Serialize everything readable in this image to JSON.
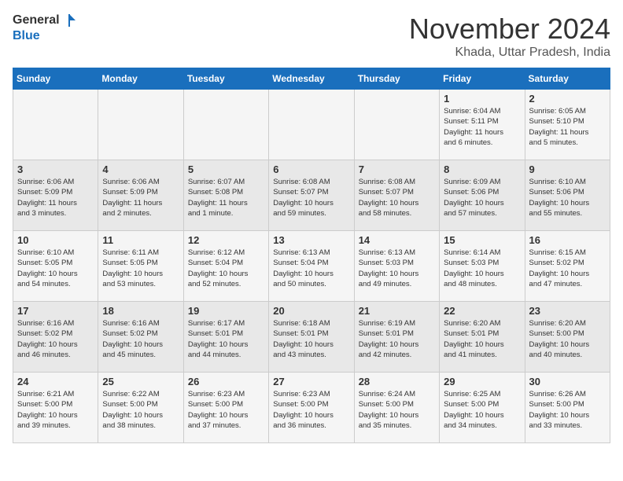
{
  "header": {
    "logo_general": "General",
    "logo_blue": "Blue",
    "month_title": "November 2024",
    "subtitle": "Khada, Uttar Pradesh, India"
  },
  "weekdays": [
    "Sunday",
    "Monday",
    "Tuesday",
    "Wednesday",
    "Thursday",
    "Friday",
    "Saturday"
  ],
  "weeks": [
    [
      {
        "day": "",
        "info": ""
      },
      {
        "day": "",
        "info": ""
      },
      {
        "day": "",
        "info": ""
      },
      {
        "day": "",
        "info": ""
      },
      {
        "day": "",
        "info": ""
      },
      {
        "day": "1",
        "info": "Sunrise: 6:04 AM\nSunset: 5:11 PM\nDaylight: 11 hours\nand 6 minutes."
      },
      {
        "day": "2",
        "info": "Sunrise: 6:05 AM\nSunset: 5:10 PM\nDaylight: 11 hours\nand 5 minutes."
      }
    ],
    [
      {
        "day": "3",
        "info": "Sunrise: 6:06 AM\nSunset: 5:09 PM\nDaylight: 11 hours\nand 3 minutes."
      },
      {
        "day": "4",
        "info": "Sunrise: 6:06 AM\nSunset: 5:09 PM\nDaylight: 11 hours\nand 2 minutes."
      },
      {
        "day": "5",
        "info": "Sunrise: 6:07 AM\nSunset: 5:08 PM\nDaylight: 11 hours\nand 1 minute."
      },
      {
        "day": "6",
        "info": "Sunrise: 6:08 AM\nSunset: 5:07 PM\nDaylight: 10 hours\nand 59 minutes."
      },
      {
        "day": "7",
        "info": "Sunrise: 6:08 AM\nSunset: 5:07 PM\nDaylight: 10 hours\nand 58 minutes."
      },
      {
        "day": "8",
        "info": "Sunrise: 6:09 AM\nSunset: 5:06 PM\nDaylight: 10 hours\nand 57 minutes."
      },
      {
        "day": "9",
        "info": "Sunrise: 6:10 AM\nSunset: 5:06 PM\nDaylight: 10 hours\nand 55 minutes."
      }
    ],
    [
      {
        "day": "10",
        "info": "Sunrise: 6:10 AM\nSunset: 5:05 PM\nDaylight: 10 hours\nand 54 minutes."
      },
      {
        "day": "11",
        "info": "Sunrise: 6:11 AM\nSunset: 5:05 PM\nDaylight: 10 hours\nand 53 minutes."
      },
      {
        "day": "12",
        "info": "Sunrise: 6:12 AM\nSunset: 5:04 PM\nDaylight: 10 hours\nand 52 minutes."
      },
      {
        "day": "13",
        "info": "Sunrise: 6:13 AM\nSunset: 5:04 PM\nDaylight: 10 hours\nand 50 minutes."
      },
      {
        "day": "14",
        "info": "Sunrise: 6:13 AM\nSunset: 5:03 PM\nDaylight: 10 hours\nand 49 minutes."
      },
      {
        "day": "15",
        "info": "Sunrise: 6:14 AM\nSunset: 5:03 PM\nDaylight: 10 hours\nand 48 minutes."
      },
      {
        "day": "16",
        "info": "Sunrise: 6:15 AM\nSunset: 5:02 PM\nDaylight: 10 hours\nand 47 minutes."
      }
    ],
    [
      {
        "day": "17",
        "info": "Sunrise: 6:16 AM\nSunset: 5:02 PM\nDaylight: 10 hours\nand 46 minutes."
      },
      {
        "day": "18",
        "info": "Sunrise: 6:16 AM\nSunset: 5:02 PM\nDaylight: 10 hours\nand 45 minutes."
      },
      {
        "day": "19",
        "info": "Sunrise: 6:17 AM\nSunset: 5:01 PM\nDaylight: 10 hours\nand 44 minutes."
      },
      {
        "day": "20",
        "info": "Sunrise: 6:18 AM\nSunset: 5:01 PM\nDaylight: 10 hours\nand 43 minutes."
      },
      {
        "day": "21",
        "info": "Sunrise: 6:19 AM\nSunset: 5:01 PM\nDaylight: 10 hours\nand 42 minutes."
      },
      {
        "day": "22",
        "info": "Sunrise: 6:20 AM\nSunset: 5:01 PM\nDaylight: 10 hours\nand 41 minutes."
      },
      {
        "day": "23",
        "info": "Sunrise: 6:20 AM\nSunset: 5:00 PM\nDaylight: 10 hours\nand 40 minutes."
      }
    ],
    [
      {
        "day": "24",
        "info": "Sunrise: 6:21 AM\nSunset: 5:00 PM\nDaylight: 10 hours\nand 39 minutes."
      },
      {
        "day": "25",
        "info": "Sunrise: 6:22 AM\nSunset: 5:00 PM\nDaylight: 10 hours\nand 38 minutes."
      },
      {
        "day": "26",
        "info": "Sunrise: 6:23 AM\nSunset: 5:00 PM\nDaylight: 10 hours\nand 37 minutes."
      },
      {
        "day": "27",
        "info": "Sunrise: 6:23 AM\nSunset: 5:00 PM\nDaylight: 10 hours\nand 36 minutes."
      },
      {
        "day": "28",
        "info": "Sunrise: 6:24 AM\nSunset: 5:00 PM\nDaylight: 10 hours\nand 35 minutes."
      },
      {
        "day": "29",
        "info": "Sunrise: 6:25 AM\nSunset: 5:00 PM\nDaylight: 10 hours\nand 34 minutes."
      },
      {
        "day": "30",
        "info": "Sunrise: 6:26 AM\nSunset: 5:00 PM\nDaylight: 10 hours\nand 33 minutes."
      }
    ]
  ]
}
